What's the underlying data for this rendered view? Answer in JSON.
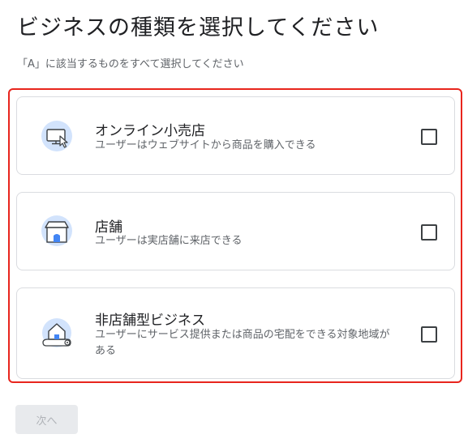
{
  "header": {
    "title": "ビジネスの種類を選択してください",
    "subtitle": "「A」に該当するものをすべて選択してください"
  },
  "options": [
    {
      "title": "オンライン小売店",
      "description": "ユーザーはウェブサイトから商品を購入できる",
      "icon": "computer-cursor-icon",
      "checked": false
    },
    {
      "title": "店舗",
      "description": "ユーザーは実店舗に来店できる",
      "icon": "storefront-icon",
      "checked": false
    },
    {
      "title": "非店舗型ビジネス",
      "description": "ユーザーにサービス提供または商品の宅配をできる対象地域がある",
      "icon": "house-map-pin-icon",
      "checked": false
    }
  ],
  "footer": {
    "next_label": "次へ",
    "next_enabled": false
  },
  "colors": {
    "highlight_border": "#e8251d",
    "icon_background": "#d2e3fc",
    "icon_accent": "#4285f4",
    "button_disabled_bg": "#e8eaed"
  }
}
